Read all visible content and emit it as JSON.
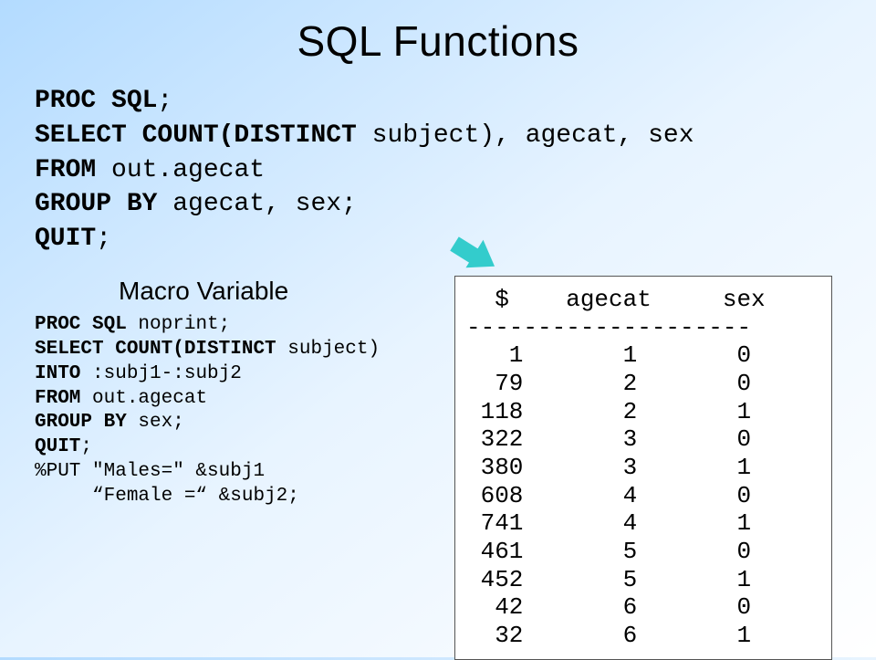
{
  "title": "SQL Functions",
  "main_code": {
    "l1_kw": "PROC SQL",
    "l1_rest": ";",
    "l2_kw": "SELECT COUNT(DISTINCT",
    "l2_rest": " subject), agecat, sex",
    "l3_kw": "FROM",
    "l3_rest": " out.agecat",
    "l4_kw": "GROUP BY",
    "l4_rest": " agecat, sex;",
    "l5_kw": "QUIT",
    "l5_rest": ";"
  },
  "subheading": "Macro Variable",
  "small_code": {
    "l1_kw": "PROC SQL",
    "l1_rest": " noprint;",
    "l2_kw": "SELECT COUNT(DISTINCT",
    "l2_rest": " subject)",
    "l3_kw": "INTO",
    "l3_rest": " :subj1-:subj2",
    "l4_kw": "FROM",
    "l4_rest": " out.agecat",
    "l5_kw": "GROUP BY",
    "l5_rest": " sex;",
    "l6_kw": "QUIT",
    "l6_rest": ";",
    "l7": "%PUT \"Males=\" &subj1",
    "l8": "     “Female =“ &subj2;"
  },
  "output": {
    "header": "  $    agecat     sex",
    "divider": "--------------------",
    "rows": [
      "   1       1       0",
      "  79       2       0",
      " 118       2       1",
      " 322       3       0",
      " 380       3       1",
      " 608       4       0",
      " 741       4       1",
      " 461       5       0",
      " 452       5       1",
      "  42       6       0",
      "  32       6       1"
    ]
  },
  "chart_data": {
    "type": "table",
    "columns": [
      "$",
      "agecat",
      "sex"
    ],
    "rows": [
      [
        1,
        1,
        0
      ],
      [
        79,
        2,
        0
      ],
      [
        118,
        2,
        1
      ],
      [
        322,
        3,
        0
      ],
      [
        380,
        3,
        1
      ],
      [
        608,
        4,
        0
      ],
      [
        741,
        4,
        1
      ],
      [
        461,
        5,
        0
      ],
      [
        452,
        5,
        1
      ],
      [
        42,
        6,
        0
      ],
      [
        32,
        6,
        1
      ]
    ]
  }
}
